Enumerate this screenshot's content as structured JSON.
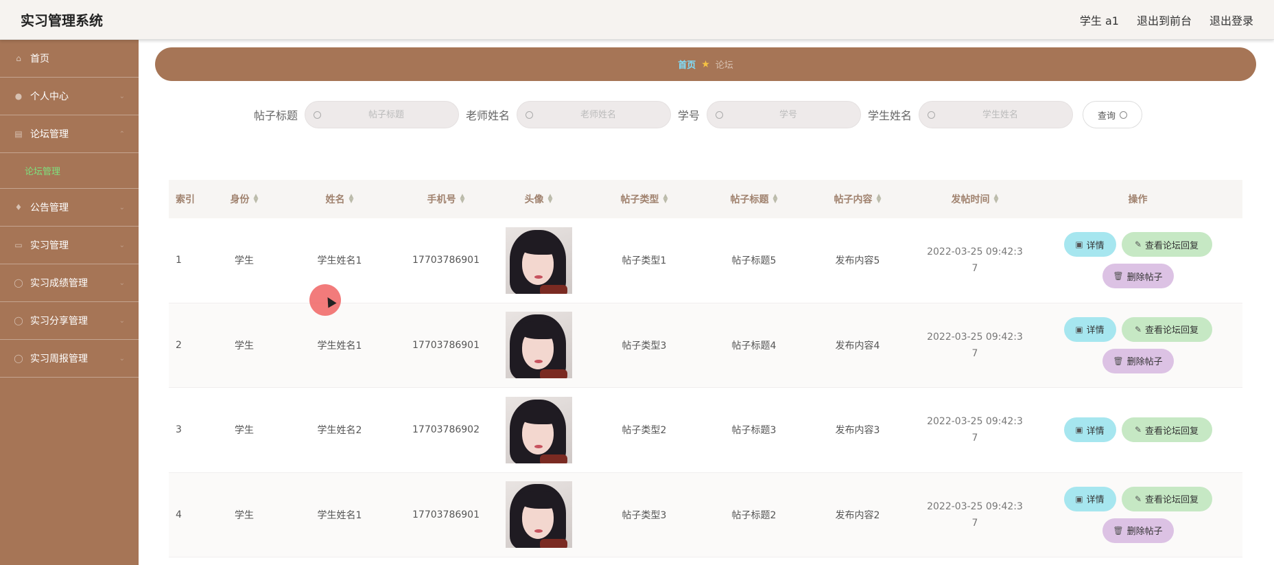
{
  "app": {
    "title": "实习管理系统"
  },
  "topbar": {
    "user": "学生 a1",
    "front": "退出到前台",
    "logout": "退出登录"
  },
  "sidebar": {
    "items": [
      {
        "label": "首页",
        "icon": "home-icon"
      },
      {
        "label": "个人中心",
        "icon": "user-icon"
      },
      {
        "label": "论坛管理",
        "icon": "document-icon"
      },
      {
        "label": "公告管理",
        "icon": "bulb-icon"
      },
      {
        "label": "实习管理",
        "icon": "shop-icon"
      },
      {
        "label": "实习成绩管理",
        "icon": "info-icon"
      },
      {
        "label": "实习分享管理",
        "icon": "share-icon"
      },
      {
        "label": "实习周报管理",
        "icon": "report-icon"
      }
    ],
    "sub_active": "论坛管理"
  },
  "breadcrumb": {
    "home": "首页",
    "current": "论坛"
  },
  "search": {
    "title_label": "帖子标题",
    "title_placeholder": "帖子标题",
    "teacher_label": "老师姓名",
    "teacher_placeholder": "老师姓名",
    "sno_label": "学号",
    "sno_placeholder": "学号",
    "student_label": "学生姓名",
    "student_placeholder": "学生姓名",
    "query_label": "查询"
  },
  "table": {
    "headers": {
      "index": "索引",
      "role": "身份",
      "name": "姓名",
      "phone": "手机号",
      "avatar": "头像",
      "type": "帖子类型",
      "title": "帖子标题",
      "content": "帖子内容",
      "time": "发帖时间",
      "ops": "操作"
    },
    "rows": [
      {
        "index": "1",
        "role": "学生",
        "name": "学生姓名1",
        "phone": "17703786901",
        "type": "帖子类型1",
        "title": "帖子标题5",
        "content": "发布内容5",
        "time": "2022-03-25 09:42:37"
      },
      {
        "index": "2",
        "role": "学生",
        "name": "学生姓名1",
        "phone": "17703786901",
        "type": "帖子类型3",
        "title": "帖子标题4",
        "content": "发布内容4",
        "time": "2022-03-25 09:42:37"
      },
      {
        "index": "3",
        "role": "学生",
        "name": "学生姓名2",
        "phone": "17703786902",
        "type": "帖子类型2",
        "title": "帖子标题3",
        "content": "发布内容3",
        "time": "2022-03-25 09:42:37"
      },
      {
        "index": "4",
        "role": "学生",
        "name": "学生姓名1",
        "phone": "17703786901",
        "type": "帖子类型3",
        "title": "帖子标题2",
        "content": "发布内容2",
        "time": "2022-03-25 09:42:37"
      }
    ],
    "buttons": {
      "detail": "详情",
      "reply": "查看论坛回复",
      "delete": "删除帖子"
    }
  },
  "colors": {
    "sidebar": "#a67556",
    "accent_home": "#7ee0ff",
    "detail_btn": "#a6e6ef",
    "reply_btn": "#c6e8c4",
    "delete_btn": "#dcc2e4"
  }
}
